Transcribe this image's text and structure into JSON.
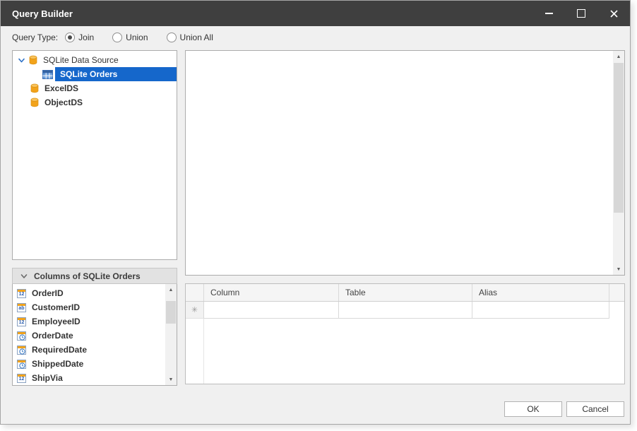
{
  "window": {
    "title": "Query Builder"
  },
  "query_type": {
    "label": "Query Type:",
    "options": [
      {
        "label": "Join",
        "selected": true
      },
      {
        "label": "Union",
        "selected": false
      },
      {
        "label": "Union All",
        "selected": false
      }
    ]
  },
  "datasource_tree": {
    "items": [
      {
        "label": "SQLite Data Source",
        "type": "datasource",
        "expanded": true,
        "selected": false
      },
      {
        "label": "SQLite Orders",
        "type": "table",
        "expanded": false,
        "selected": true
      },
      {
        "label": "ExcelDS",
        "type": "datasource",
        "expanded": false,
        "selected": false
      },
      {
        "label": "ObjectDS",
        "type": "datasource",
        "expanded": false,
        "selected": false
      }
    ]
  },
  "columns_panel": {
    "header": "Columns of SQLite Orders",
    "items": [
      {
        "icon": "12",
        "type": "numeric",
        "label": "OrderID"
      },
      {
        "icon": "ab",
        "type": "text",
        "label": "CustomerID"
      },
      {
        "icon": "12",
        "type": "numeric",
        "label": "EmployeeID"
      },
      {
        "icon": "clock",
        "type": "date",
        "label": "OrderDate"
      },
      {
        "icon": "clock",
        "type": "date",
        "label": "RequiredDate"
      },
      {
        "icon": "clock",
        "type": "date",
        "label": "ShippedDate"
      },
      {
        "icon": "12",
        "type": "numeric",
        "label": "ShipVia"
      }
    ]
  },
  "grid": {
    "columns": [
      "Column",
      "Table",
      "Alias"
    ],
    "new_row_marker": "✳"
  },
  "footer": {
    "ok_label": "OK",
    "cancel_label": "Cancel"
  },
  "colors": {
    "titlebar": "#3f3f3f",
    "selection_blue": "#1567cb",
    "accent_orange": "#f2a31b",
    "dialog_background": "#f0f0f0"
  }
}
